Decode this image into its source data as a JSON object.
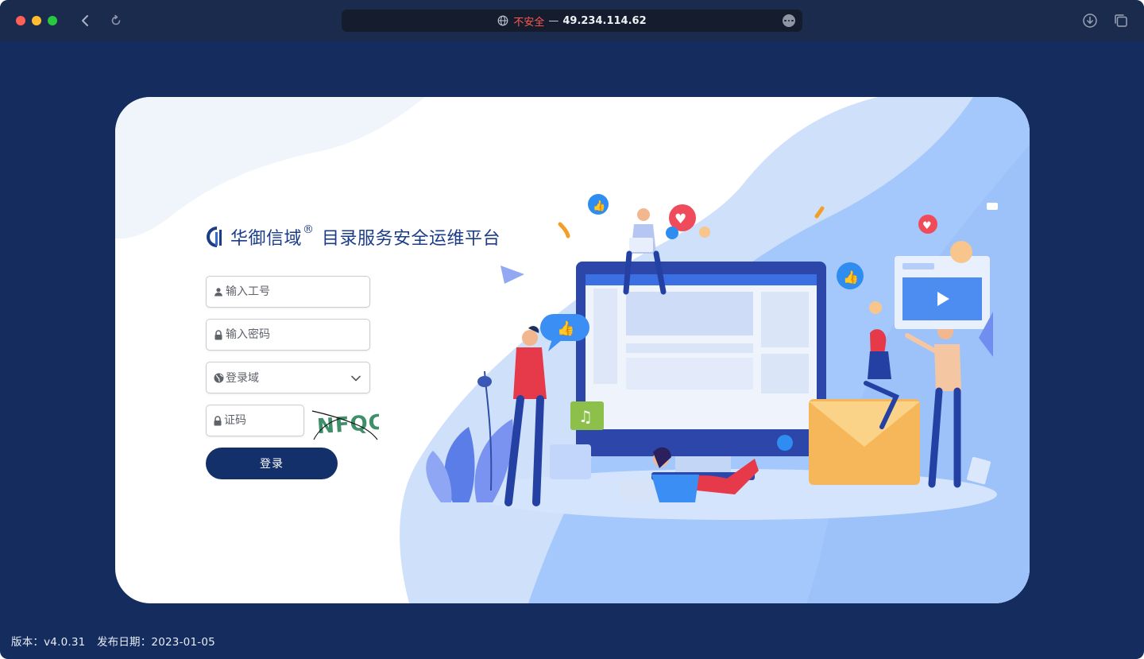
{
  "browser": {
    "security_label": "不安全",
    "separator": "—",
    "host": "49.234.114.62"
  },
  "brand": {
    "name": "华御信域",
    "registered": "®",
    "subtitle": "目录服务安全运维平台"
  },
  "form": {
    "username_placeholder": "输入工号",
    "password_placeholder": "输入密码",
    "domain_placeholder": "登录域",
    "captcha_placeholder": "证码",
    "captcha_text": "NFQC",
    "login_label": "登录"
  },
  "footer": {
    "version": "版本：v4.0.31",
    "release_date": "发布日期：2023-01-05"
  },
  "colors": {
    "page_bg": "#142d5e",
    "brand": "#1b3c88",
    "button": "#14306a",
    "insecure": "#ff5a4e"
  },
  "icons": [
    "globe-icon",
    "back-icon",
    "reload-icon",
    "more-icon",
    "download-icon",
    "tabs-icon",
    "user-icon",
    "lock-icon",
    "chevron-down-icon"
  ]
}
